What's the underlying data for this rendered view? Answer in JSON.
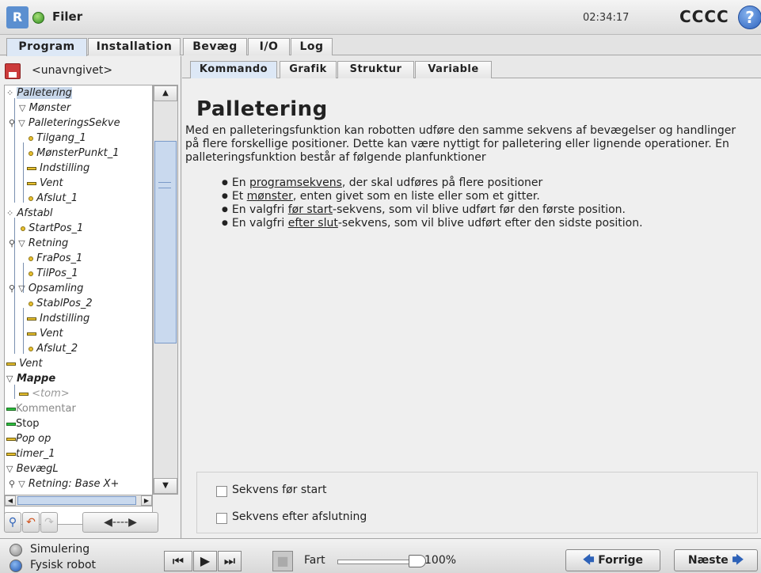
{
  "header": {
    "title": "Filer",
    "clock": "02:34:17",
    "robot_name": "CCCC",
    "help_glyph": "?"
  },
  "main_tabs": [
    {
      "label": "Program",
      "active": true
    },
    {
      "label": "Installation",
      "active": false
    },
    {
      "label": "Bevæg",
      "active": false
    },
    {
      "label": "I/O",
      "active": false
    },
    {
      "label": "Log",
      "active": false
    }
  ],
  "file": {
    "name": "<unavngivet>"
  },
  "tree": [
    {
      "label": "Palletering",
      "icon": "pallet",
      "selected": true
    },
    {
      "label": "Mønster",
      "icon": "folder-triangle"
    },
    {
      "label": "PalleteringsSekve",
      "icon": "folder-triangle"
    },
    {
      "label": "Tilgang_1",
      "icon": "waypoint"
    },
    {
      "label": "MønsterPunkt_1",
      "icon": "waypoint"
    },
    {
      "label": "Indstilling",
      "icon": "bar"
    },
    {
      "label": "Vent",
      "icon": "bar"
    },
    {
      "label": "Afslut_1",
      "icon": "waypoint"
    },
    {
      "label": "Afstabl",
      "icon": "pallet"
    },
    {
      "label": "StartPos_1",
      "icon": "waypoint"
    },
    {
      "label": "Retning",
      "icon": "folder-triangle"
    },
    {
      "label": "FraPos_1",
      "icon": "waypoint"
    },
    {
      "label": "TilPos_1",
      "icon": "waypoint"
    },
    {
      "label": "Opsamling",
      "icon": "folder-triangle"
    },
    {
      "label": "StablPos_2",
      "icon": "waypoint"
    },
    {
      "label": "Indstilling",
      "icon": "bar"
    },
    {
      "label": "Vent",
      "icon": "bar"
    },
    {
      "label": "Afslut_2",
      "icon": "waypoint"
    },
    {
      "label": "Vent",
      "icon": "bar"
    },
    {
      "label": "Mappe",
      "icon": "folder-triangle"
    },
    {
      "label": "<tom>",
      "icon": "bar"
    },
    {
      "label": "Kommentar",
      "icon": "bar-green"
    },
    {
      "label": "Stop",
      "icon": "bar-green"
    },
    {
      "label": "Pop op",
      "icon": "bar"
    },
    {
      "label": "timer_1",
      "icon": "bar"
    },
    {
      "label": "BevægL",
      "icon": "folder-triangle"
    },
    {
      "label": "Retning: Base X+",
      "icon": "folder-triangle"
    }
  ],
  "sub_tabs": [
    {
      "label": "Kommando",
      "active": true
    },
    {
      "label": "Grafik",
      "active": false
    },
    {
      "label": "Struktur",
      "active": false
    },
    {
      "label": "Variable",
      "active": false
    }
  ],
  "content": {
    "title": "Palletering",
    "intro": "Med en palleteringsfunktion kan robotten udføre den samme sekvens af bevægelser og handlinger på flere forskellige positioner. Dette kan være nyttigt for palletering eller lignende operationer. En palleteringsfunktion består af følgende planfunktioner",
    "bullets": [
      {
        "pre": "En ",
        "link": "programsekvens",
        "post": ", der skal udføres på flere positioner"
      },
      {
        "pre": "Et ",
        "link": "mønster",
        "post": ", enten givet som en liste eller som et gitter."
      },
      {
        "pre": "En valgfri ",
        "link": "før start",
        "post": "-sekvens, som vil blive udført før den første position."
      },
      {
        "pre": "En valgfri ",
        "link": "efter slut",
        "post": "-sekvens, som vil blive udført efter den sidste position."
      }
    ],
    "options": [
      {
        "label": "Sekvens før start",
        "checked": false
      },
      {
        "label": "Sekvens efter afslutning",
        "checked": false
      }
    ]
  },
  "footer": {
    "mode_simulation": "Simulering",
    "mode_real": "Fysisk robot",
    "speed_label": "Fart",
    "speed_value": "100%",
    "speed_fraction": 1.0,
    "prev_label": "Forrige",
    "next_label": "Næste"
  },
  "colors": {
    "accent": "#2e62b8",
    "tab_active": "#dde8f6",
    "status_ok": "#2e8c1c"
  }
}
